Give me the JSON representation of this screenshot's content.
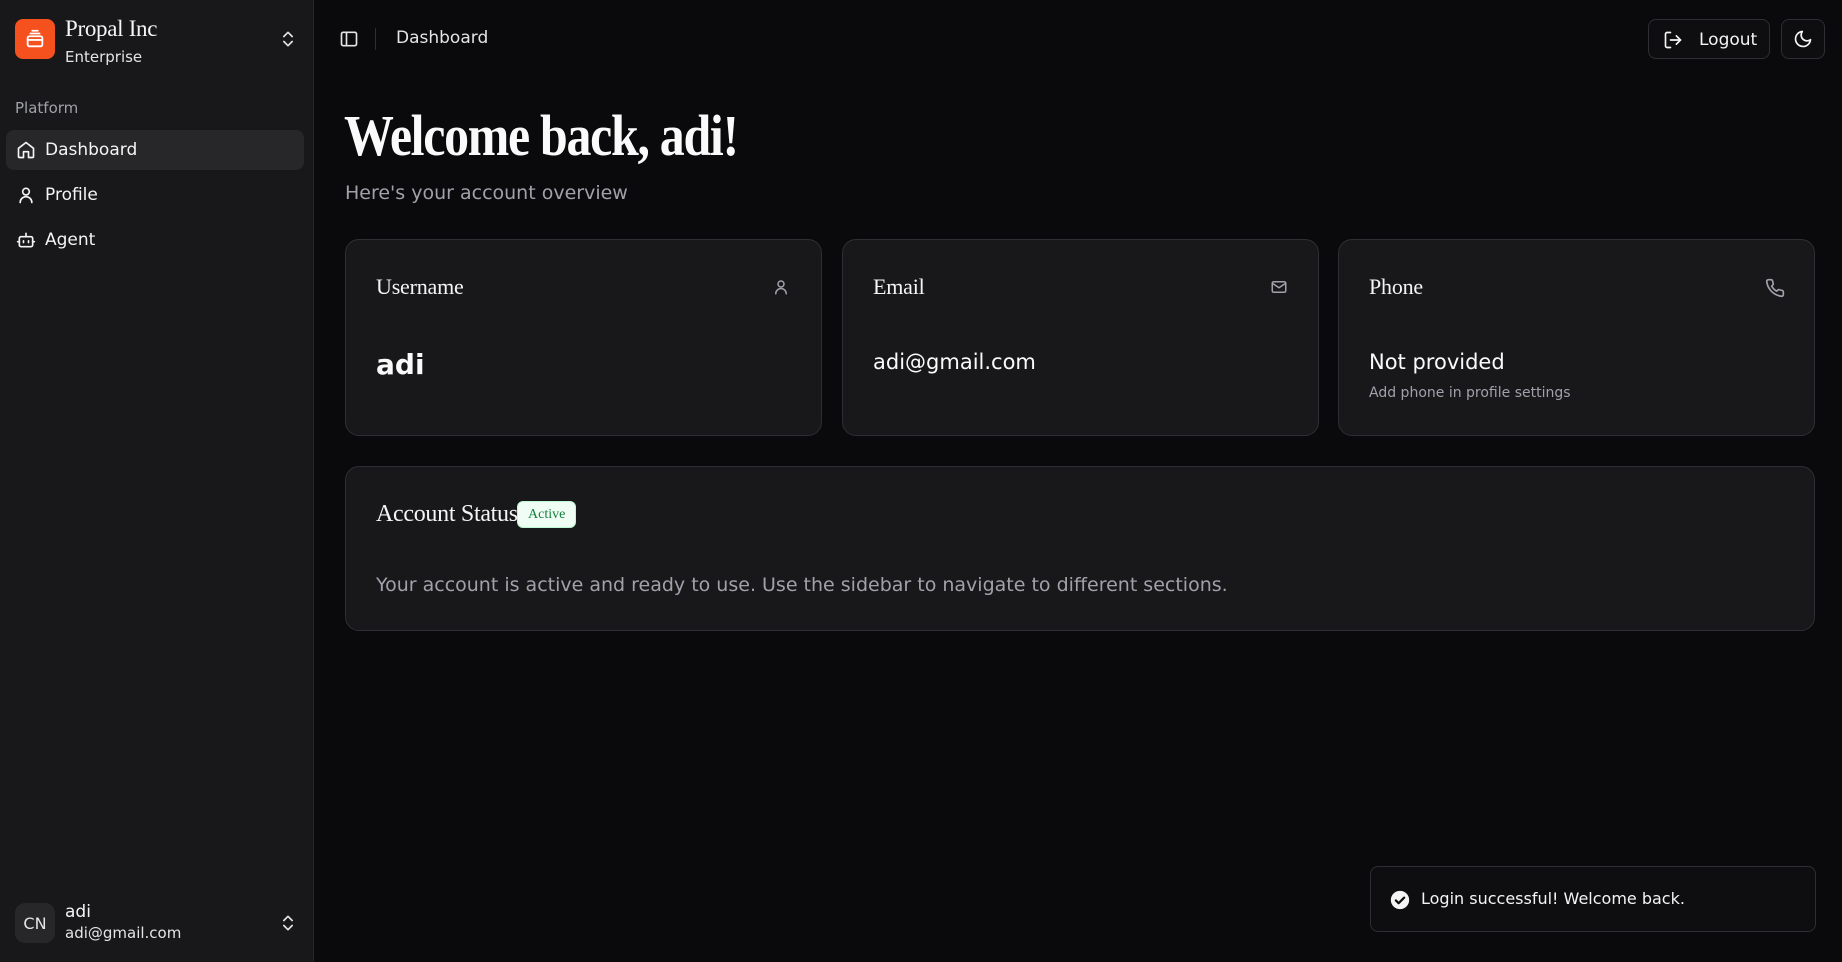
{
  "team": {
    "name": "Propal Inc",
    "plan": "Enterprise"
  },
  "nav": {
    "group_label": "Platform",
    "items": [
      {
        "label": "Dashboard",
        "icon": "home-icon",
        "active": true
      },
      {
        "label": "Profile",
        "icon": "user-icon",
        "active": false
      },
      {
        "label": "Agent",
        "icon": "bot-icon",
        "active": false
      }
    ]
  },
  "user": {
    "initials": "CN",
    "name": "adi",
    "email": "adi@gmail.com"
  },
  "header": {
    "breadcrumb": "Dashboard",
    "logout_label": "Logout",
    "theme_icon": "moon-icon"
  },
  "page": {
    "title": "Welcome back, adi!",
    "subtitle": "Here's your account overview"
  },
  "cards": [
    {
      "title": "Username",
      "value": "adi",
      "icon": "user-icon"
    },
    {
      "title": "Email",
      "value": "adi@gmail.com",
      "icon": "mail-icon"
    },
    {
      "title": "Phone",
      "value": "Not provided",
      "hint": "Add phone in profile settings",
      "icon": "phone-icon"
    }
  ],
  "status": {
    "title": "Account Status",
    "badge": "Active",
    "text": "Your account is active and ready to use. Use the sidebar to navigate to different sections."
  },
  "toast": {
    "message": "Login successful! Welcome back.",
    "icon": "check-circle-icon"
  },
  "colors": {
    "brand": "#f4511e",
    "background": "#0a0a0c",
    "sidebar": "#18181b",
    "badge_green": "#15803d"
  }
}
